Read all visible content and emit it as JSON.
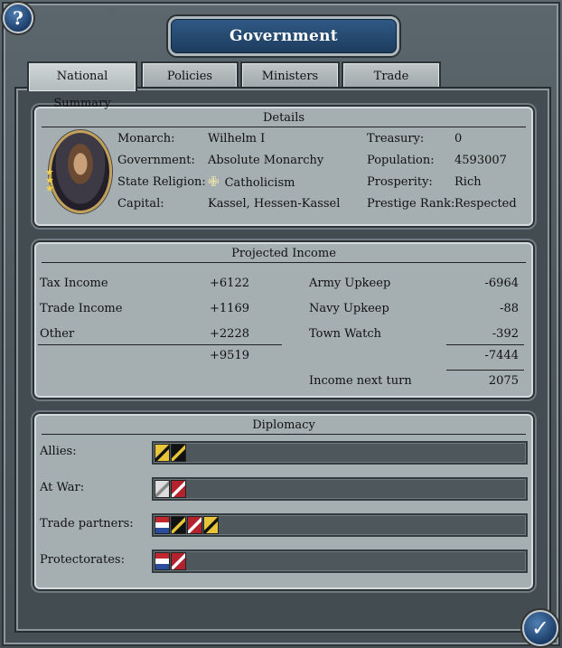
{
  "window": {
    "title": "Government"
  },
  "tabs": [
    {
      "label": "National Summary",
      "active": true
    },
    {
      "label": "Policies",
      "active": false
    },
    {
      "label": "Ministers",
      "active": false
    },
    {
      "label": "Trade",
      "active": false
    }
  ],
  "details": {
    "header": "Details",
    "rows_left": [
      {
        "label": "Monarch:",
        "value": "Wilhelm I"
      },
      {
        "label": "Government:",
        "value": "Absolute Monarchy"
      },
      {
        "label": "State Religion:",
        "value": "Catholicism"
      },
      {
        "label": "Capital:",
        "value": "Kassel, Hessen-Kassel"
      }
    ],
    "rows_right": [
      {
        "label": "Treasury:",
        "value": "0"
      },
      {
        "label": "Population:",
        "value": "4593007"
      },
      {
        "label": "Prosperity:",
        "value": "Rich"
      },
      {
        "label": "Prestige Rank:",
        "value": "Respected"
      }
    ],
    "religion_icon": "cross-icon"
  },
  "income": {
    "header": "Projected Income",
    "left": [
      {
        "label": "Tax Income",
        "value": "+6122"
      },
      {
        "label": "Trade Income",
        "value": "+1169"
      },
      {
        "label": "Other",
        "value": "+2228"
      }
    ],
    "left_total": "+9519",
    "right": [
      {
        "label": "Army Upkeep",
        "value": "-6964"
      },
      {
        "label": "Navy Upkeep",
        "value": "-88"
      },
      {
        "label": "Town Watch",
        "value": "-392"
      }
    ],
    "right_total": "-7444",
    "net_label": "Income next turn",
    "net_value": "2075"
  },
  "diplomacy": {
    "header": "Diplomacy",
    "rows": [
      {
        "label": "Allies:",
        "flags": [
          "yellow-black",
          "black-yellow"
        ]
      },
      {
        "label": "At War:",
        "flags": [
          "white-grey",
          "red-white"
        ]
      },
      {
        "label": "Trade partners:",
        "flags": [
          "red-white-blue",
          "black-yellow",
          "red-white",
          "yellow-black"
        ]
      },
      {
        "label": "Protectorates:",
        "flags": [
          "red-white-blue",
          "red-white"
        ]
      }
    ]
  },
  "colors": {
    "title_bar": "#1d3b5c",
    "panel_bg": "#a5aeb1"
  }
}
